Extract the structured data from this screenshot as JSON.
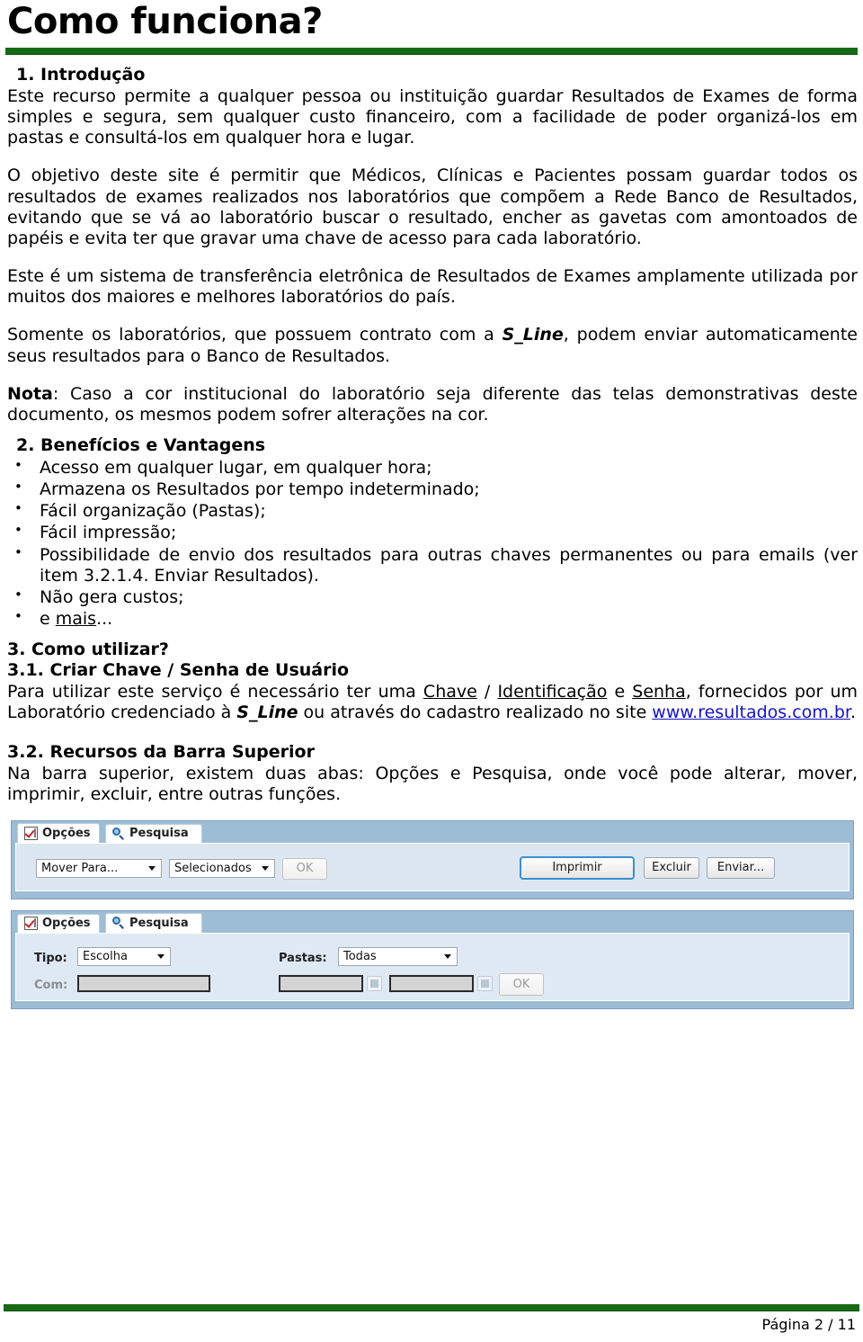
{
  "document": {
    "title": "Como funciona?",
    "accent_color": "#156b15",
    "link_color": "#1414c8"
  },
  "sections": {
    "intro": {
      "heading": "1. Introdução",
      "p1": "Este recurso permite a qualquer pessoa ou instituição guardar Resultados de Exames de forma simples e segura, sem qualquer custo financeiro, com a facilidade de poder organizá-los em pastas e consultá-los em qualquer hora e lugar.",
      "p2": "O objetivo deste site é permitir que Médicos, Clínicas e Pacientes possam guardar todos os resultados de exames realizados nos laboratórios que compõem a Rede Banco de Resultados, evitando que se vá ao laboratório buscar o resultado, encher as gavetas com amontoados de papéis e evita ter que gravar uma chave de acesso para cada laboratório.",
      "p3": "Este é um sistema de transferência eletrônica de Resultados de Exames amplamente utilizada por muitos dos maiores e melhores laboratórios do país.",
      "p4_a": "Somente os laboratórios, que possuem contrato com a ",
      "p4_brand": "S_Line",
      "p4_b": ", podem enviar automaticamente seus resultados para o Banco de Resultados.",
      "p5_label": "Nota",
      "p5_text": ": Caso a cor institucional do laboratório seja diferente das telas demonstrativas deste documento, os mesmos podem sofrer alterações na cor."
    },
    "benefits": {
      "heading": "2. Benefícios e Vantagens",
      "items": [
        "Acesso em qualquer lugar, em qualquer hora;",
        "Armazena os Resultados por tempo indeterminado;",
        "Fácil organização (Pastas);",
        "Fácil impressão;",
        "Possibilidade de envio dos resultados para outras chaves permanentes ou para emails (ver item 3.2.1.4. Enviar Resultados).",
        "Não gera custos;"
      ],
      "last_item_prefix": "e ",
      "last_item_link": "mais",
      "last_item_suffix": "..."
    },
    "howto": {
      "heading": "3. Como utilizar?",
      "sub1_heading": "3.1. Criar Chave / Senha de Usuário",
      "sub1_p_a": "Para utilizar este serviço é necessário ter uma ",
      "sub1_chave": "Chave",
      "sub1_sep": " / ",
      "sub1_ident": "Identificação",
      "sub1_and": " e ",
      "sub1_senha": "Senha",
      "sub1_p_b": ", fornecidos por um Laboratório credenciado à ",
      "sub1_brand": "S_Line",
      "sub1_p_c": " ou através do cadastro realizado no site ",
      "sub1_url": "www.resultados.com.br",
      "sub1_p_d": ".",
      "sub2_heading": "3.2. Recursos da Barra Superior",
      "sub2_p": "Na barra superior, existem duas abas: Opções e Pesquisa, onde você pode alterar, mover, imprimir, excluir, entre outras funções."
    }
  },
  "screenshot_options": {
    "tabs": [
      {
        "label": "Opções",
        "icon": "checklist-icon",
        "active": true
      },
      {
        "label": "Pesquisa",
        "icon": "magnifier-icon",
        "active": false
      }
    ],
    "move_to_select": "Mover Para...",
    "scope_select": "Selecionados",
    "ok_button": "OK",
    "print_button": "Imprimir",
    "delete_button": "Excluir",
    "send_button": "Enviar..."
  },
  "screenshot_search": {
    "tabs": [
      {
        "label": "Opções",
        "icon": "checklist-icon",
        "active": false
      },
      {
        "label": "Pesquisa",
        "icon": "magnifier-icon",
        "active": true
      }
    ],
    "tipo_label": "Tipo:",
    "tipo_select": "Escolha",
    "com_label": "Com:",
    "com_value": "",
    "pastas_label": "Pastas:",
    "pastas_select": "Todas",
    "date_from": "",
    "date_to": "",
    "ok_button": "OK"
  },
  "footer": {
    "page_label": "Página 2 / 11"
  }
}
